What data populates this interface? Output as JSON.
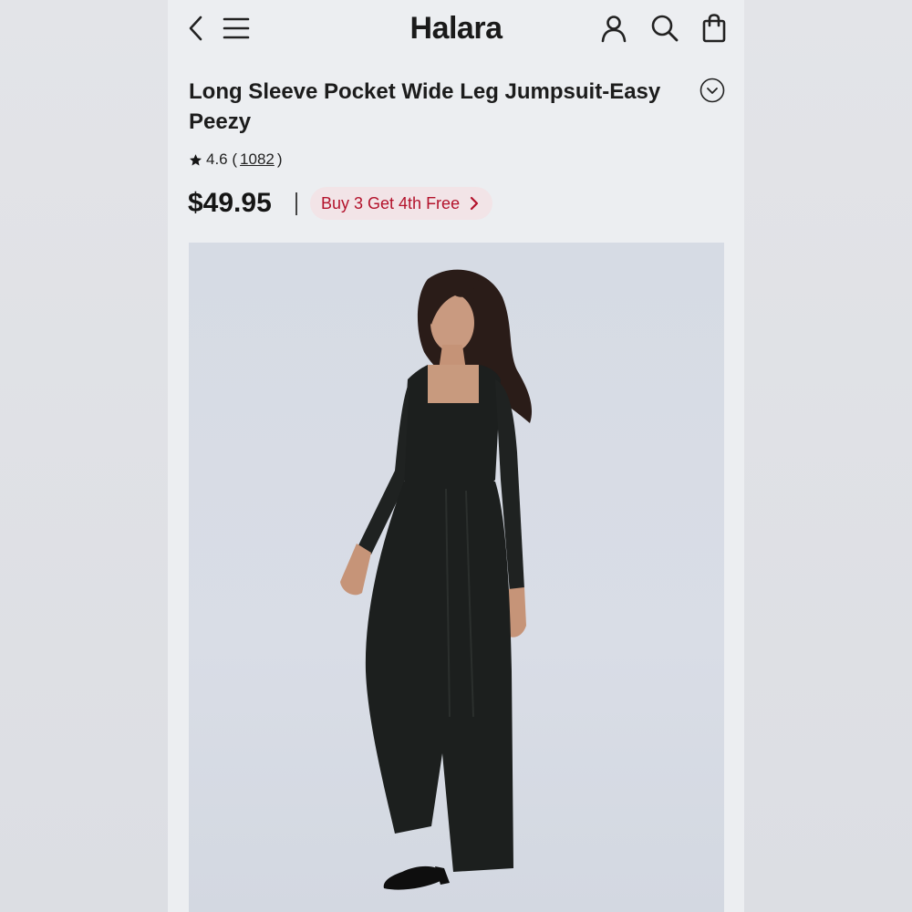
{
  "header": {
    "brand": "Halara",
    "icons": [
      "chevron-left-icon",
      "hamburger-menu-icon",
      "account-icon",
      "search-icon",
      "shopping-bag-icon"
    ]
  },
  "product": {
    "title": "Long Sleeve Pocket Wide Leg Jumpsuit-Easy Peezy",
    "rating": "4.6",
    "review_count": "1082",
    "price": "$49.95",
    "promo": "Buy 3 Get 4th Free"
  },
  "colors": {
    "promo_text": "#b3122b",
    "promo_bg": "#f2e4e7",
    "photo_bg": "#d6dbe4",
    "garment": "#1c1f1e"
  }
}
